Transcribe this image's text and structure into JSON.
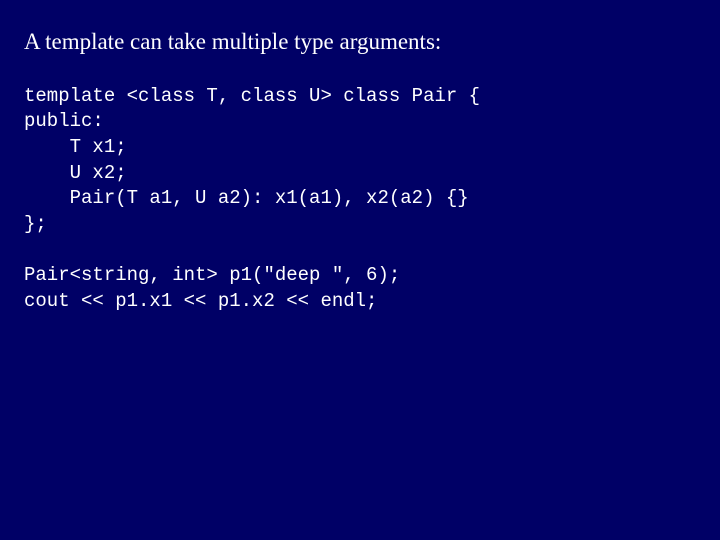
{
  "slide": {
    "heading": "A template can take multiple type arguments:",
    "code1": "template <class T, class U> class Pair {\npublic:\n    T x1;\n    U x2;\n    Pair(T a1, U a2): x1(a1), x2(a2) {}\n};",
    "code2": "Pair<string, int> p1(\"deep \", 6);\ncout << p1.x1 << p1.x2 << endl;"
  }
}
